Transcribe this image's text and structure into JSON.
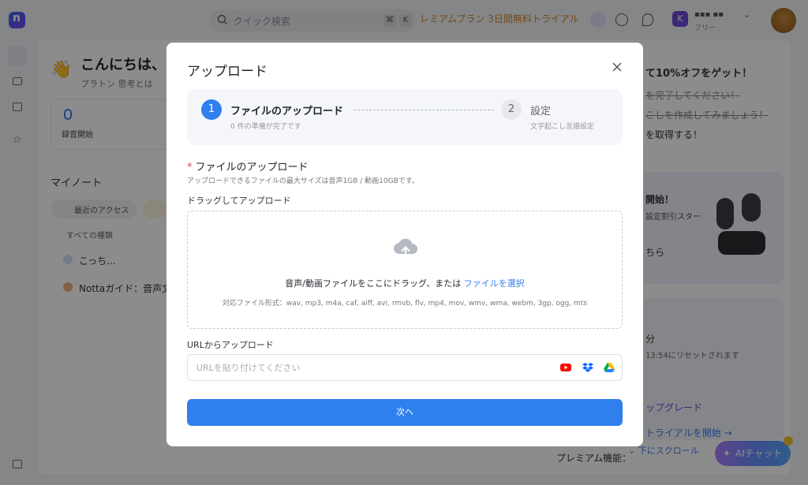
{
  "topbar": {
    "search_placeholder": "クイック検索",
    "shortcut_key1": "⌘",
    "shortcut_key2": "K",
    "premium_trial": "レミアムプラン 3日間無料トライアル",
    "user_initial": "K",
    "user_name": "▪▪▪ ▪▪",
    "user_plan": "フリー"
  },
  "background": {
    "greeting": "こんにちは、",
    "greeting_sub": "思考とは",
    "greeting_sub_prefix": "プラトン",
    "record_start": "録音開始",
    "my_notes": "マイノート",
    "recent_access": "最近のアクセス",
    "all_kinds": "すべての種類",
    "note1": "こっち...",
    "note2": "Nottaガイド：音声文",
    "right_1": "て10%オフをゲット！",
    "right_2": "を完了してください！",
    "right_3": "こしを作成してみましょう！",
    "right_4": "を取得する！",
    "right_5": "開始！",
    "right_6": "設定割引スター",
    "right_7": "ちら",
    "right_8": "分",
    "right_9": "13:54にリセットされます",
    "right_10": "ップグレード",
    "right_11": "トライアルを開始 →",
    "scroll_down": "下にスクロール",
    "premium_func": "プレミアム機能：",
    "ai_chat": "AIチャット"
  },
  "modal": {
    "title": "アップロード",
    "steps": [
      {
        "number": "1",
        "title": "ファイルのアップロード",
        "subtitle": "0 件の準備が完了です"
      },
      {
        "number": "2",
        "title": "設定",
        "subtitle": "文字起こし言語設定"
      }
    ],
    "section_title": "ファイルのアップロード",
    "required_mark": "*",
    "section_sub": "アップロードできるファイルの最大サイズは音声1GB / 動画10GBです。",
    "drag_label": "ドラッグしてアップロード",
    "drop_text": "音声/動画ファイルをここにドラッグ、または",
    "drop_link": "ファイルを選択",
    "drop_formats": "対応ファイル形式：wav, mp3, m4a, caf, aiff, avi, rmvb, flv, mp4, mov, wmv, wma, webm, 3gp, ogg, mts",
    "url_label": "URLからアップロード",
    "url_placeholder": "URLを貼り付けてください",
    "url_value": "",
    "url_sources": [
      "youtube-icon",
      "dropbox-icon",
      "google-drive-icon"
    ],
    "next_button": "次へ"
  },
  "colors": {
    "accent": "#2f80ed",
    "required": "#e5484d",
    "premium": "#d4882a"
  }
}
